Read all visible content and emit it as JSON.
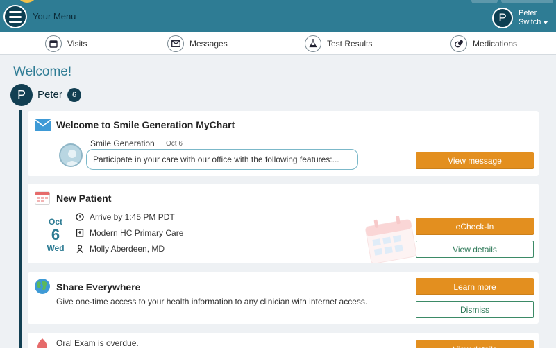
{
  "header": {
    "menu_label": "Your Menu",
    "user_initial": "P",
    "user_name": "Peter",
    "user_action": "Switch"
  },
  "nav": {
    "items": [
      {
        "label": "Visits",
        "icon": "calendar-icon"
      },
      {
        "label": "Messages",
        "icon": "envelope-icon"
      },
      {
        "label": "Test Results",
        "icon": "flask-icon"
      },
      {
        "label": "Medications",
        "icon": "pill-icon"
      }
    ]
  },
  "main": {
    "welcome": "Welcome!",
    "patient_initial": "P",
    "patient_name": "Peter",
    "notification_count": "6"
  },
  "cards": {
    "message": {
      "title": "Welcome to Smile Generation MyChart",
      "sender": "Smile Generation",
      "date": "Oct 6",
      "preview": "Participate in your care with our office with the following features:...",
      "button": "View message"
    },
    "appointment": {
      "title": "New Patient",
      "month": "Oct",
      "day": "6",
      "weekday": "Wed",
      "arrive": "Arrive by 1:45 PM PDT",
      "location": "Modern HC Primary Care",
      "provider": "Molly Aberdeen, MD",
      "primary_button": "eCheck-In",
      "secondary_button": "View details"
    },
    "share": {
      "title": "Share Everywhere",
      "description": "Give one-time access to your health information to any clinician with internet access.",
      "primary_button": "Learn more",
      "secondary_button": "Dismiss"
    },
    "overdue": {
      "text": "Oral Exam is overdue.",
      "button": "View details"
    }
  },
  "colors": {
    "header": "#2e7c94",
    "accent_orange": "#e38f1f",
    "outline_green": "#3b8a66",
    "dark_navy": "#123f52"
  }
}
